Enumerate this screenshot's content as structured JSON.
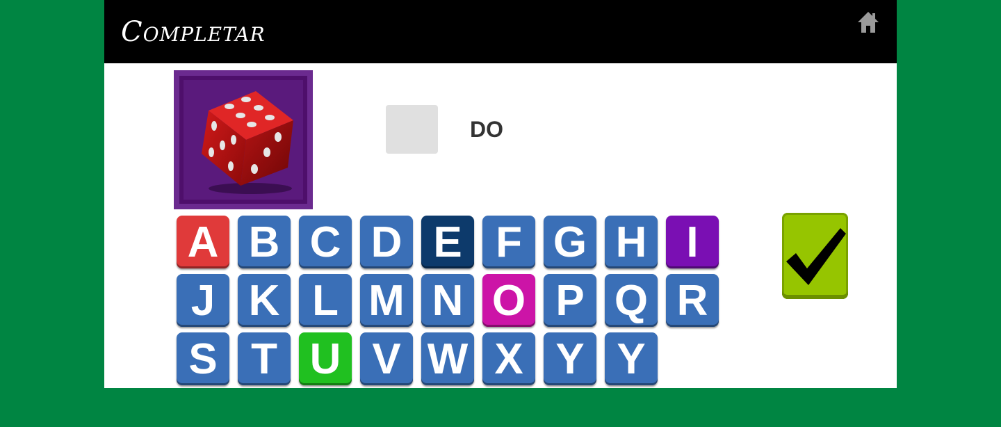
{
  "header": {
    "title": "Completar",
    "home_icon": "home-icon"
  },
  "colors": {
    "background": "#008542",
    "tile_default": "#3a6fb7",
    "tile_a": "#e03a3a",
    "tile_e": "#0d3a6b",
    "tile_i": "#7a0fb3",
    "tile_o": "#cc14a7",
    "tile_u": "#20c020",
    "check": "#96c500"
  },
  "puzzle": {
    "picture": "red-dice-image",
    "blank_slot": "",
    "word_fragment": "DO"
  },
  "letters": [
    "A",
    "B",
    "C",
    "D",
    "E",
    "F",
    "G",
    "H",
    "I",
    "J",
    "K",
    "L",
    "M",
    "N",
    "O",
    "P",
    "Q",
    "R",
    "S",
    "T",
    "U",
    "V",
    "W",
    "X",
    "Y",
    "Y"
  ],
  "submit_icon": "checkmark-icon"
}
